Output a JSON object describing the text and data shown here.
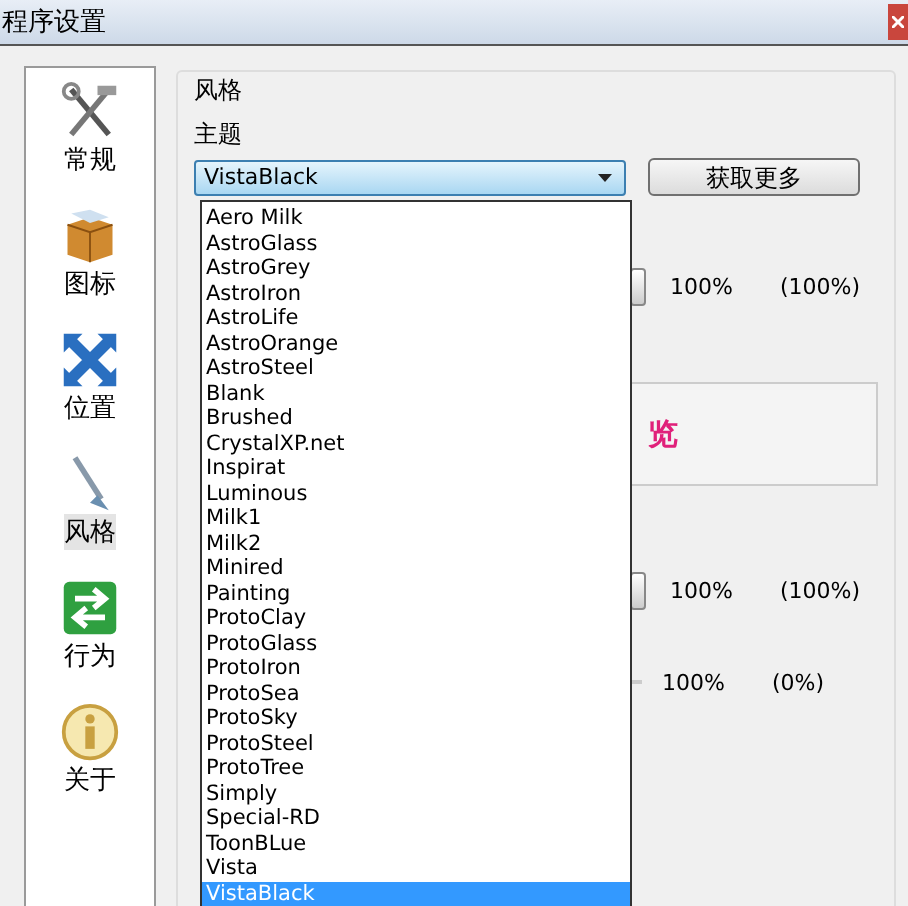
{
  "window": {
    "title": "程序设置"
  },
  "sidebar": {
    "items": [
      {
        "label": "常规",
        "kind": "tools",
        "selected": false
      },
      {
        "label": "图标",
        "kind": "box",
        "selected": false
      },
      {
        "label": "位置",
        "kind": "arrows",
        "selected": false
      },
      {
        "label": "风格",
        "kind": "brush",
        "selected": true
      },
      {
        "label": "行为",
        "kind": "switch",
        "selected": false
      },
      {
        "label": "关于",
        "kind": "info",
        "selected": false
      }
    ]
  },
  "group": {
    "title": "风格",
    "theme_label": "主题",
    "theme_value": "VistaBlack",
    "more_button": "获取更多",
    "rows": [
      {
        "value": "100%",
        "default": "(100%)",
        "kind": "thumb"
      },
      {
        "kind": "preview",
        "text": "览"
      },
      {
        "value": "100%",
        "default": "(100%)",
        "kind": "thumb"
      },
      {
        "value": "100%",
        "default": "(0%)",
        "kind": "line"
      }
    ]
  },
  "dropdown": {
    "items": [
      {
        "label": "Aero Milk",
        "selected": false
      },
      {
        "label": "AstroGlass",
        "selected": false
      },
      {
        "label": "AstroGrey",
        "selected": false
      },
      {
        "label": "AstroIron",
        "selected": false
      },
      {
        "label": "AstroLife",
        "selected": false
      },
      {
        "label": "AstroOrange",
        "selected": false
      },
      {
        "label": "AstroSteel",
        "selected": false
      },
      {
        "label": "Blank",
        "selected": false
      },
      {
        "label": "Brushed",
        "selected": false
      },
      {
        "label": "CrystalXP.net",
        "selected": false
      },
      {
        "label": "Inspirat",
        "selected": false
      },
      {
        "label": "Luminous",
        "selected": false
      },
      {
        "label": "Milk1",
        "selected": false
      },
      {
        "label": "Milk2",
        "selected": false
      },
      {
        "label": "Minired",
        "selected": false
      },
      {
        "label": "Painting",
        "selected": false
      },
      {
        "label": "ProtoClay",
        "selected": false
      },
      {
        "label": "ProtoGlass",
        "selected": false
      },
      {
        "label": "ProtoIron",
        "selected": false
      },
      {
        "label": "ProtoSea",
        "selected": false
      },
      {
        "label": "ProtoSky",
        "selected": false
      },
      {
        "label": "ProtoSteel",
        "selected": false
      },
      {
        "label": "ProtoTree",
        "selected": false
      },
      {
        "label": "Simply",
        "selected": false
      },
      {
        "label": "Special-RD",
        "selected": false
      },
      {
        "label": "ToonBLue",
        "selected": false
      },
      {
        "label": "Vista",
        "selected": false
      },
      {
        "label": "VistaBlack",
        "selected": true
      }
    ]
  }
}
